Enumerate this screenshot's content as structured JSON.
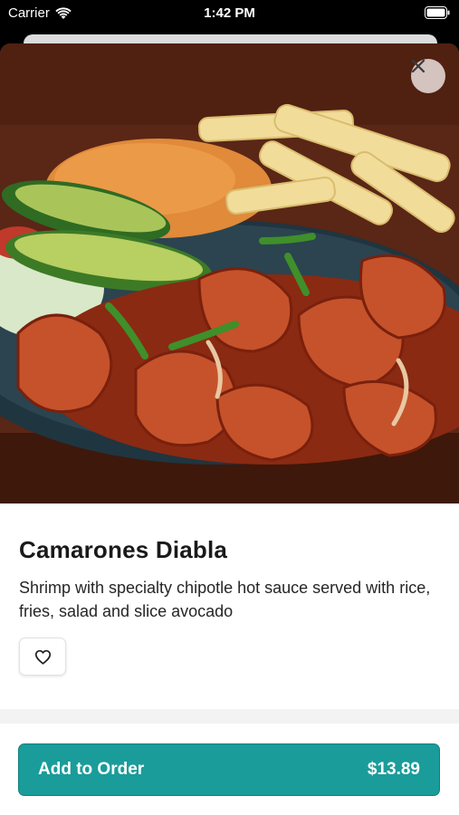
{
  "status_bar": {
    "carrier": "Carrier",
    "time": "1:42 PM"
  },
  "item": {
    "name": "Camarones Diabla",
    "description": "Shrimp with specialty chipotle hot sauce served with rice, fries, salad and slice avocado"
  },
  "footer": {
    "add_label": "Add to Order",
    "price": "$13.89"
  },
  "icons": {
    "close": "close-icon",
    "favorite": "heart-outline-icon",
    "wifi": "wifi-icon",
    "battery": "battery-icon"
  },
  "colors": {
    "accent": "#1a9c9a",
    "status_bar_bg": "#000000"
  }
}
